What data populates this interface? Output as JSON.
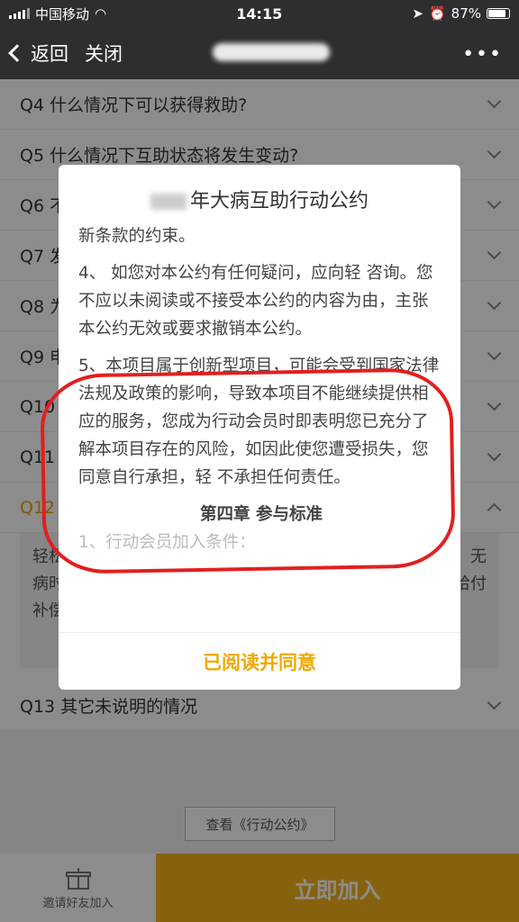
{
  "status": {
    "carrier": "中国移动",
    "time": "14:15",
    "battery": "87%"
  },
  "nav": {
    "back": "返回",
    "close": "关闭",
    "more": "•••"
  },
  "faq": [
    {
      "q": "Q4 什么情况下可以获得救助?"
    },
    {
      "q": "Q5 什么情况下互助状态将发生变动?"
    },
    {
      "q": "Q6 不"
    },
    {
      "q": "Q7 发"
    },
    {
      "q": "Q8 为"
    },
    {
      "q": "Q9 申"
    },
    {
      "q": "Q10"
    },
    {
      "q": "Q11"
    },
    {
      "q": "Q12"
    }
  ],
  "faq_expanded": {
    "left": [
      "轻松",
      "病时",
      "补偿"
    ],
    "right": [
      "无",
      "给付"
    ]
  },
  "faq_after": "Q13 其它未说明的情况",
  "view_covenant": "查看《行动公约》",
  "invite": "邀请好友加入",
  "join": "立即加入",
  "modal": {
    "title": "年大病互助行动公约",
    "p1": "新条款的约束。",
    "p2": "4、 如您对本公约有任何疑问，应向轻 咨询。您不应以未阅读或不接受本公约的内容为由，主张本公约无效或要求撤销本公约。",
    "p3": "5、本项目属于创新型项目，可能会受到国家法律法规及政策的影响，导致本项目不能继续提供相应的服务，您成为行动会员时即表明您已充分了解本项目存在的风险，如因此使您遭受损失，您同意自行承担，轻 不承担任何责任。",
    "chapter": "第四章 参与标准",
    "faded": "1、行动会员加入条件：",
    "confirm": "已阅读并同意"
  }
}
